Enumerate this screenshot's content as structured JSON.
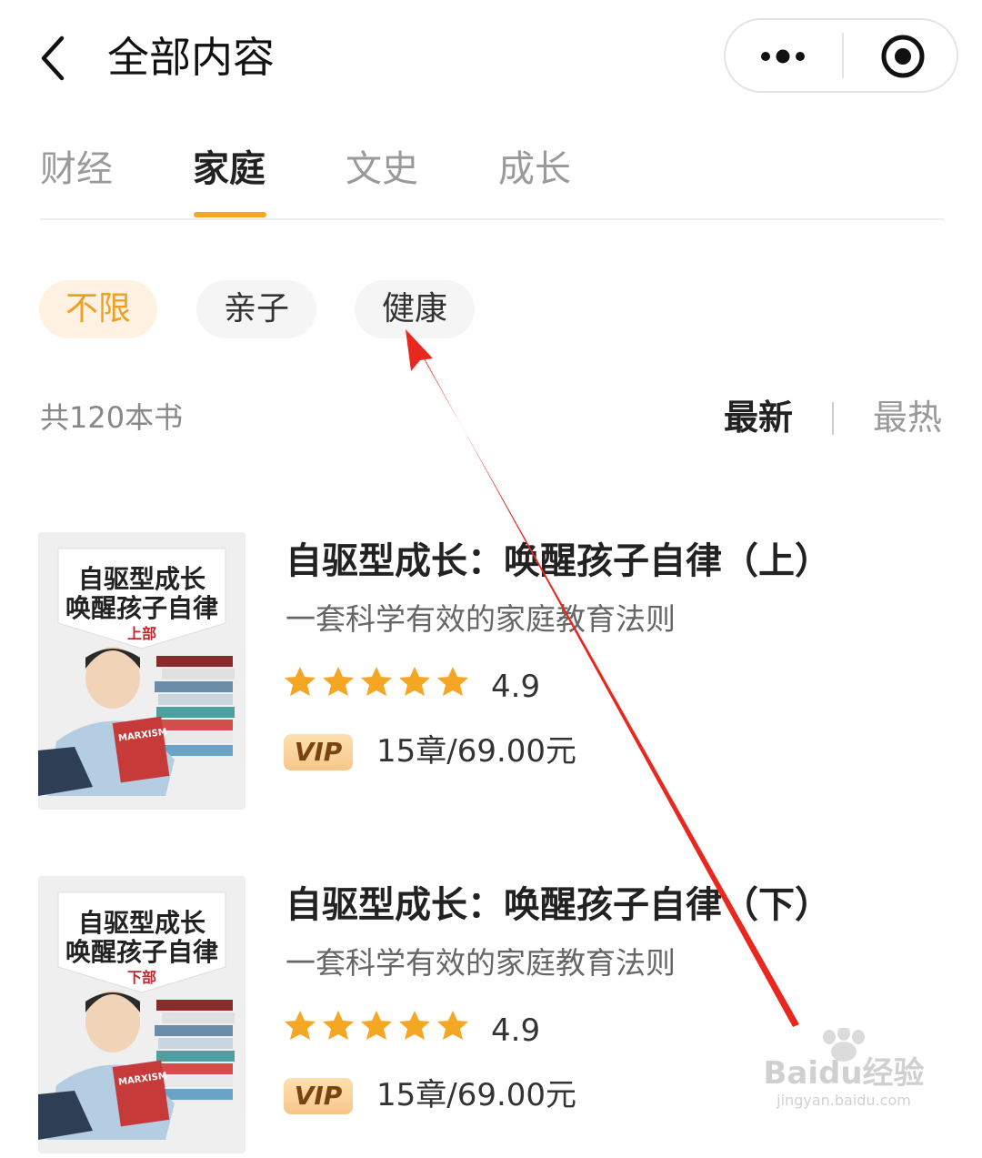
{
  "header": {
    "title": "全部内容"
  },
  "tabs": [
    {
      "label": "财经",
      "active": false
    },
    {
      "label": "家庭",
      "active": true
    },
    {
      "label": "文史",
      "active": false
    },
    {
      "label": "成长",
      "active": false
    }
  ],
  "filters": [
    {
      "label": "不限",
      "active": true
    },
    {
      "label": "亲子",
      "active": false
    },
    {
      "label": "健康",
      "active": false
    }
  ],
  "list_header": {
    "count_text": "共120本书",
    "sort_latest": "最新",
    "sort_hot": "最热",
    "active_sort": "最新"
  },
  "books": [
    {
      "title": "自驱型成长：唤醒孩子自律（上）",
      "subtitle": "一套科学有效的家庭教育法则",
      "rating": "4.9",
      "stars": 5,
      "badge": "VIP",
      "price": "15章/69.00元",
      "cover": {
        "line1": "自驱型成长",
        "line2": "唤醒孩子自律",
        "part": "上部",
        "book_text": "MARXISM"
      }
    },
    {
      "title": "自驱型成长：唤醒孩子自律（下）",
      "subtitle": "一套科学有效的家庭教育法则",
      "rating": "4.9",
      "stars": 5,
      "badge": "VIP",
      "price": "15章/69.00元",
      "cover": {
        "line1": "自驱型成长",
        "line2": "唤醒孩子自律",
        "part": "下部",
        "book_text": "MARXISM"
      }
    }
  ],
  "watermark": {
    "brand": "Baidu经验",
    "url": "jingyan.baidu.com"
  },
  "colors": {
    "accent": "#f5a623",
    "annotation_arrow": "#e8281f",
    "star": "#f5a623"
  },
  "icons": [
    "back-arrow-icon",
    "more-dots-icon",
    "target-close-icon",
    "star-icon",
    "annotation-arrow"
  ]
}
